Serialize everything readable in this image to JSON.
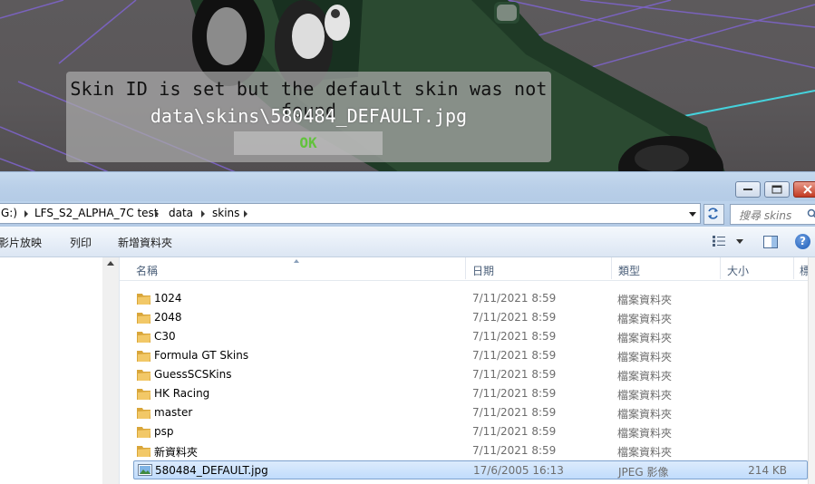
{
  "game_dialog": {
    "message": "Skin ID is set but the default skin was not found",
    "path": "data\\skins\\580484_DEFAULT.jpg",
    "ok_label": "OK"
  },
  "explorer": {
    "breadcrumb": [
      "G:)",
      "LFS_S2_ALPHA_7C test",
      "data",
      "skins"
    ],
    "search_placeholder": "搜尋 skins",
    "toolbar": {
      "item1": "影片放映",
      "print": "列印",
      "new_folder": "新增資料夾"
    },
    "columns": {
      "name": "名稱",
      "date": "日期",
      "type": "類型",
      "size": "大小",
      "tags": "標"
    },
    "rows": [
      {
        "name": "1024",
        "date": "7/11/2021 8:59",
        "type": "檔案資料夾",
        "size": "",
        "kind": "folder"
      },
      {
        "name": "2048",
        "date": "7/11/2021 8:59",
        "type": "檔案資料夾",
        "size": "",
        "kind": "folder"
      },
      {
        "name": "C30",
        "date": "7/11/2021 8:59",
        "type": "檔案資料夾",
        "size": "",
        "kind": "folder"
      },
      {
        "name": "Formula GT Skins",
        "date": "7/11/2021 8:59",
        "type": "檔案資料夾",
        "size": "",
        "kind": "folder"
      },
      {
        "name": "GuessSCSKins",
        "date": "7/11/2021 8:59",
        "type": "檔案資料夾",
        "size": "",
        "kind": "folder"
      },
      {
        "name": "HK Racing",
        "date": "7/11/2021 8:59",
        "type": "檔案資料夾",
        "size": "",
        "kind": "folder"
      },
      {
        "name": "master",
        "date": "7/11/2021 8:59",
        "type": "檔案資料夾",
        "size": "",
        "kind": "folder"
      },
      {
        "name": "psp",
        "date": "7/11/2021 8:59",
        "type": "檔案資料夾",
        "size": "",
        "kind": "folder"
      },
      {
        "name": "新資料夾",
        "date": "7/11/2021 8:59",
        "type": "檔案資料夾",
        "size": "",
        "kind": "folder"
      },
      {
        "name": "580484_DEFAULT.jpg",
        "date": "17/6/2005 16:13",
        "type": "JPEG 影像",
        "size": "214 KB",
        "kind": "jpeg",
        "selected": true
      }
    ]
  },
  "colors": {
    "ok_text": "#62c23c",
    "selection": "#c1dcfc",
    "folder": "#e8b94a"
  }
}
